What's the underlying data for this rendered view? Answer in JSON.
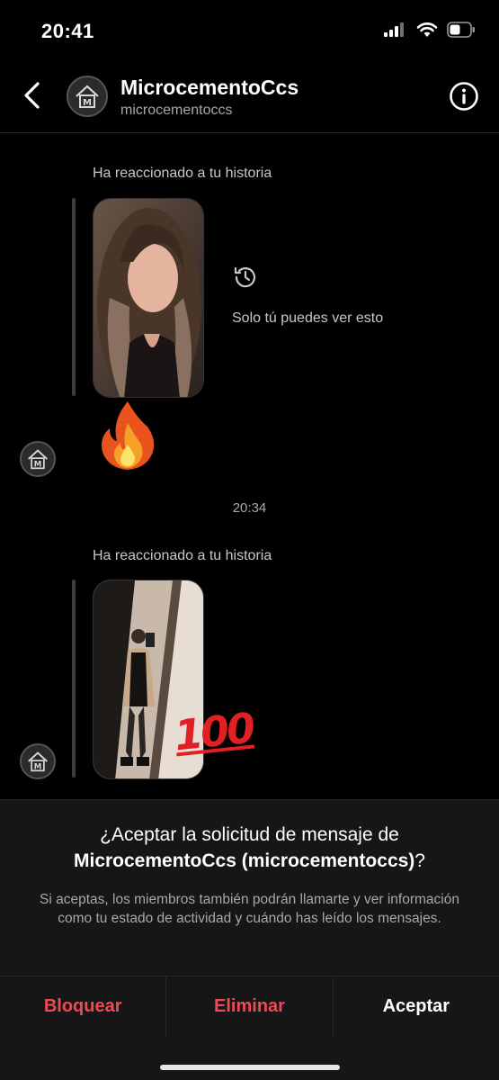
{
  "status_bar": {
    "time": "20:41",
    "icons": [
      "signal-icon",
      "wifi-icon",
      "battery-icon"
    ]
  },
  "header": {
    "name": "MicrocementoCcs",
    "handle": "microcementoccs",
    "back_icon": "chevron-left-icon",
    "info_icon": "info-icon"
  },
  "chat": {
    "messages": [
      {
        "label": "Ha reaccionado a tu historia",
        "private_note": "Solo tú puedes ver esto",
        "reaction_icon": "fire-emoji"
      },
      {
        "separator_time": "20:34",
        "label": "Ha reaccionado a tu historia",
        "reaction_icon": "hundred-points-emoji",
        "reaction_text": "100"
      }
    ]
  },
  "request": {
    "title_prefix": "¿Aceptar la solicitud de mensaje de",
    "title_name": "MicrocementoCcs (microcementoccs)",
    "title_suffix": "?",
    "description": "Si aceptas, los miembros también podrán llamarte y ver información como tu estado de actividad y cuándo has leído los mensajes."
  },
  "actions": {
    "block": "Bloquear",
    "delete": "Eliminar",
    "accept": "Aceptar"
  },
  "colors": {
    "background": "#000000",
    "panel": "#161616",
    "danger": "#ed4956",
    "muted": "#a8a8a8"
  }
}
